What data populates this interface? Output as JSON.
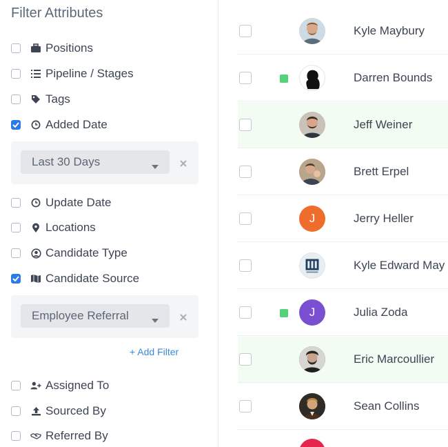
{
  "sidebar": {
    "title": "Filter Attributes",
    "filters": [
      {
        "label": "Positions",
        "checked": false,
        "icon": "briefcase-icon"
      },
      {
        "label": "Pipeline / Stages",
        "checked": false,
        "icon": "list-icon"
      },
      {
        "label": "Tags",
        "checked": false,
        "icon": "tag-icon"
      },
      {
        "label": "Added Date",
        "checked": true,
        "icon": "clock-icon"
      },
      {
        "label": "Update Date",
        "checked": false,
        "icon": "clock-icon"
      },
      {
        "label": "Locations",
        "checked": false,
        "icon": "map-pin-icon"
      },
      {
        "label": "Candidate Type",
        "checked": false,
        "icon": "user-circle-icon"
      },
      {
        "label": "Candidate Source",
        "checked": true,
        "icon": "map-icon"
      },
      {
        "label": "Assigned To",
        "checked": false,
        "icon": "user-plus-icon"
      },
      {
        "label": "Sourced By",
        "checked": false,
        "icon": "upload-icon"
      },
      {
        "label": "Referred By",
        "checked": false,
        "icon": "handshake-icon"
      }
    ],
    "added_date_select": "Last 30 Days",
    "candidate_source_select": "Employee Referral",
    "add_filter": "+ Add Filter"
  },
  "candidates": [
    {
      "name": "Kyle Maybury",
      "status": false,
      "highlight": false,
      "avatar": "photo",
      "avatar_color": "#c9a58a"
    },
    {
      "name": "Darren Bounds",
      "status": true,
      "highlight": false,
      "avatar": "silhouette",
      "avatar_color": "#111111"
    },
    {
      "name": "Jeff Weiner",
      "status": false,
      "highlight": true,
      "avatar": "photo",
      "avatar_color": "#6b5043"
    },
    {
      "name": "Brett Erpel",
      "status": false,
      "highlight": false,
      "avatar": "photo",
      "avatar_color": "#7a6a5a"
    },
    {
      "name": "Jerry Heller",
      "status": false,
      "highlight": false,
      "avatar": "initial",
      "initial": "J",
      "avatar_color": "#ee6d2d"
    },
    {
      "name": "Kyle Edward May",
      "status": false,
      "highlight": false,
      "avatar": "logo",
      "avatar_color": "#1f3f63"
    },
    {
      "name": "Julia Zoda",
      "status": true,
      "highlight": false,
      "avatar": "initial",
      "initial": "J",
      "avatar_color": "#7b4fd1"
    },
    {
      "name": "Eric Marcoullier",
      "status": false,
      "highlight": true,
      "avatar": "photo",
      "avatar_color": "#3e3a38"
    },
    {
      "name": "Sean Collins",
      "status": false,
      "highlight": false,
      "avatar": "photo",
      "avatar_color": "#8a6a3a"
    }
  ],
  "colors": {
    "accent": "#2c7be5",
    "status_green": "#55d179",
    "highlight_row": "#f3fcf2",
    "link": "#3b8ad9"
  }
}
